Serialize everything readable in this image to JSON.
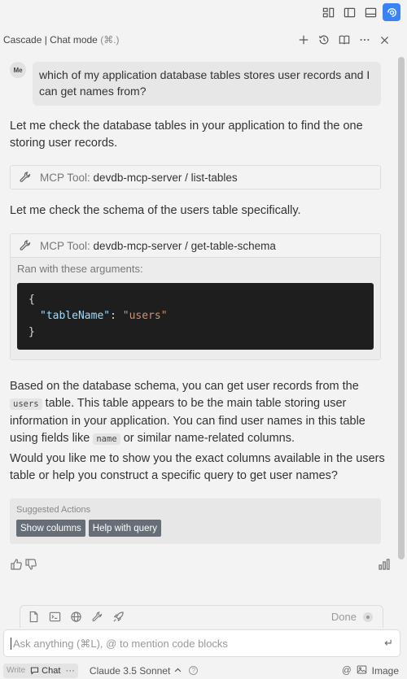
{
  "header": {
    "title": "Cascade | Chat mode",
    "shortcut": "(⌘.)"
  },
  "conversation": {
    "user_avatar": "Me",
    "user_message": "which of my application database tables stores user records and I can get names from?",
    "assistant_intro": "Let me check the database tables in your application to find the one storing user records.",
    "tool1": {
      "prefix": "MCP Tool:",
      "name": "devdb-mcp-server / list-tables"
    },
    "assistant_mid": "Let me check the schema of the users table specifically.",
    "tool2": {
      "prefix": "MCP Tool:",
      "name": "devdb-mcp-server / get-table-schema",
      "args_label": "Ran with these arguments:",
      "code_open": "{",
      "code_key": "\"tableName\"",
      "code_sep": ": ",
      "code_value": "\"users\"",
      "code_close": "}"
    },
    "answer_part1": "Based on the database schema, you can get user records from the",
    "answer_code1": "users",
    "answer_part2": "table. This table appears to be the main table storing user information in your application. You can find user names in this table using fields like",
    "answer_code2": "name",
    "answer_part3": "or similar name-related columns.",
    "followup": "Would you like me to show you the exact columns available in the users table or help you construct a specific query to get user names?"
  },
  "suggested": {
    "label": "Suggested Actions",
    "actions": [
      "Show columns",
      "Help with query"
    ]
  },
  "composer": {
    "done_label": "Done",
    "placeholder": "Ask anything (⌘L), @ to mention code blocks",
    "enter_glyph": "↵"
  },
  "bottom_bar": {
    "write_label": "Write",
    "chat_label": "Chat",
    "more": "···",
    "model": "Claude 3.5 Sonnet",
    "help": "?",
    "mention": "@",
    "image_label": "Image"
  },
  "colors": {
    "accent": "#3b82f6",
    "action_button": "#666e78",
    "code_bg": "#1e1e1e"
  },
  "icons": {
    "top": [
      "layout-panels-icon",
      "sidebar-left-icon",
      "panel-bottom-icon",
      "windsurf-icon"
    ],
    "header": [
      "plus-icon",
      "history-icon",
      "book-icon",
      "more-icon",
      "close-icon"
    ],
    "tools": [
      "file-icon",
      "terminal-icon",
      "globe-icon",
      "tool-icon",
      "rocket-icon"
    ]
  }
}
